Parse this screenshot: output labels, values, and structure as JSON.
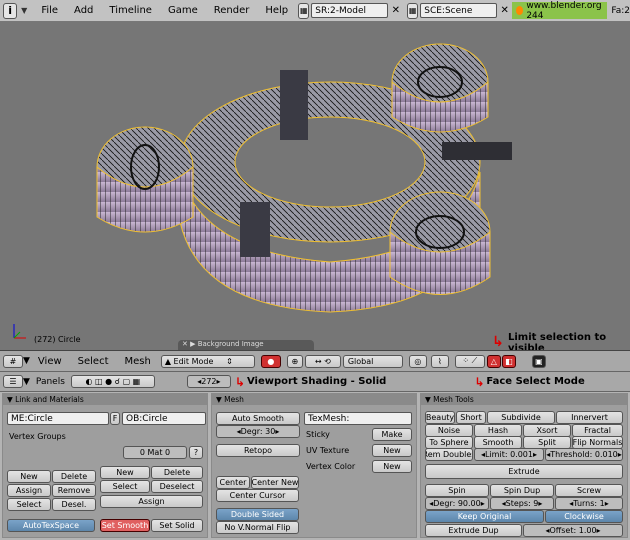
{
  "topbar": {
    "menus": [
      "File",
      "Add",
      "Timeline",
      "Game",
      "Render",
      "Help"
    ],
    "screen_field": "SR:2-Model",
    "scene_field": "SCE:Scene",
    "url": "www.blender.org 244",
    "fa": "Fa:2"
  },
  "viewport": {
    "status": "(272) Circle",
    "bg_tab": "Background Image"
  },
  "header3d": {
    "view": "View",
    "select": "Select",
    "mesh": "Mesh",
    "mode": "Edit Mode",
    "orientation": "Global"
  },
  "buttons_header": {
    "panels": "Panels",
    "frame": "272"
  },
  "annotations": {
    "limit_selection": "Limit selection to visible",
    "viewport_shading": "Viewport Shading - Solid",
    "face_select": "Face Select Mode"
  },
  "link_materials": {
    "title": "Link and Materials",
    "me_field": "ME:Circle",
    "f_label": "F",
    "ob_field": "OB:Circle",
    "vertex_groups": "Vertex Groups",
    "mat": "0 Mat 0",
    "q": "?",
    "new1": "New",
    "delete1": "Delete",
    "assign1": "Assign",
    "remove1": "Remove",
    "select1": "Select",
    "desel1": "Desel.",
    "new2": "New",
    "delete2": "Delete",
    "select2": "Select",
    "deselect2": "Deselect",
    "assign2": "Assign",
    "autotex": "AutoTexSpace",
    "set_smooth": "Set Smooth",
    "set_solid": "Set Solid"
  },
  "mesh_panel": {
    "title": "Mesh",
    "auto_smooth": "Auto Smooth",
    "degr": "Degr: 30",
    "texmesh": "TexMesh:",
    "sticky": "Sticky",
    "make": "Make",
    "retopo": "Retopo",
    "uv_texture": "UV Texture",
    "new_uv": "New",
    "vertex_color": "Vertex Color",
    "new_vc": "New",
    "center": "Center",
    "center_new": "Center New",
    "center_cursor": "Center Cursor",
    "double_sided": "Double Sided",
    "no_vnormal": "No V.Normal Flip"
  },
  "mesh_tools": {
    "title": "Mesh Tools",
    "beauty": "Beauty",
    "short": "Short",
    "subdivide": "Subdivide",
    "innervert": "Innervert",
    "noise": "Noise",
    "hash": "Hash",
    "xsort": "Xsort",
    "fractal": "Fractal",
    "to_sphere": "To Sphere",
    "smooth": "Smooth",
    "split": "Split",
    "flip_normals": "Flip Normals",
    "rem_doubles": "Rem Doubles",
    "limit": "Limit: 0.001",
    "threshold": "Threshold: 0.010",
    "extrude": "Extrude",
    "spin": "Spin",
    "spin_dup": "Spin Dup",
    "screw": "Screw",
    "degr": "Degr: 90.00",
    "steps": "Steps: 9",
    "turns": "Turns: 1",
    "keep_original": "Keep Original",
    "clockwise": "Clockwise",
    "extrude_dup": "Extrude Dup",
    "offset": "Offset: 1.00"
  }
}
